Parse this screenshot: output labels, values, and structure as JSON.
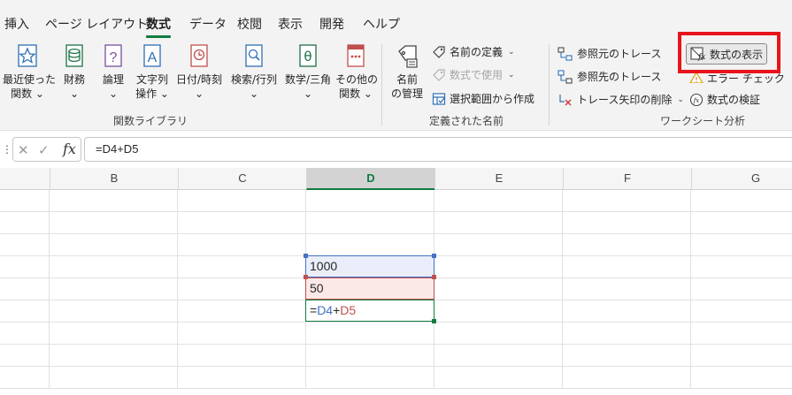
{
  "tabs": [
    "挿入",
    "ページ レイアウト",
    "数式",
    "データ",
    "校閲",
    "表示",
    "開発",
    "ヘルプ"
  ],
  "active_tab": "数式",
  "function_library": {
    "buttons": [
      {
        "line1": "最近使った",
        "line2": "関数 ⌄",
        "icon": "star-icon"
      },
      {
        "line1": "財務",
        "line2": "⌄",
        "icon": "database-icon"
      },
      {
        "line1": "論理",
        "line2": "⌄",
        "icon": "question-icon"
      },
      {
        "line1": "文字列",
        "line2": "操作 ⌄",
        "icon": "letter-a-icon"
      },
      {
        "line1": "日付/時刻",
        "line2": "⌄",
        "icon": "clock-icon"
      },
      {
        "line1": "検索/行列",
        "line2": "⌄",
        "icon": "lookup-icon"
      },
      {
        "line1": "数学/三角",
        "line2": "⌄",
        "icon": "theta-icon"
      },
      {
        "line1": "その他の",
        "line2": "関数 ⌄",
        "icon": "more-functions-icon"
      }
    ],
    "group_label": "関数ライブラリ"
  },
  "defined_names": {
    "name_manager_line1": "名前",
    "name_manager_line2": "の管理",
    "define_name": "名前の定義",
    "use_in_formula": "数式で使用",
    "create_from_selection": "選択範囲から作成",
    "group_label": "定義された名前"
  },
  "formula_auditing": {
    "trace_precedents": "参照元のトレース",
    "trace_dependents": "参照先のトレース",
    "remove_arrows": "トレース矢印の削除",
    "show_formulas": "数式の表示",
    "error_checking": "エラー チェック",
    "evaluate_formula": "数式の検証",
    "group_label": "ワークシート分析"
  },
  "formula_bar": {
    "value": "=D4+D5"
  },
  "columns": [
    "B",
    "C",
    "D",
    "E",
    "F",
    "G"
  ],
  "selected_column": "D",
  "cells": {
    "d4": "1000",
    "d5": "50",
    "d6_eq": "=",
    "d6_ref1": "D4",
    "d6_plus": "+",
    "d6_ref2": "D5"
  },
  "colors": {
    "accent": "#107c41",
    "highlight_box": "#e8141b",
    "ref_blue": "#4472c4",
    "ref_red": "#c0504d"
  }
}
